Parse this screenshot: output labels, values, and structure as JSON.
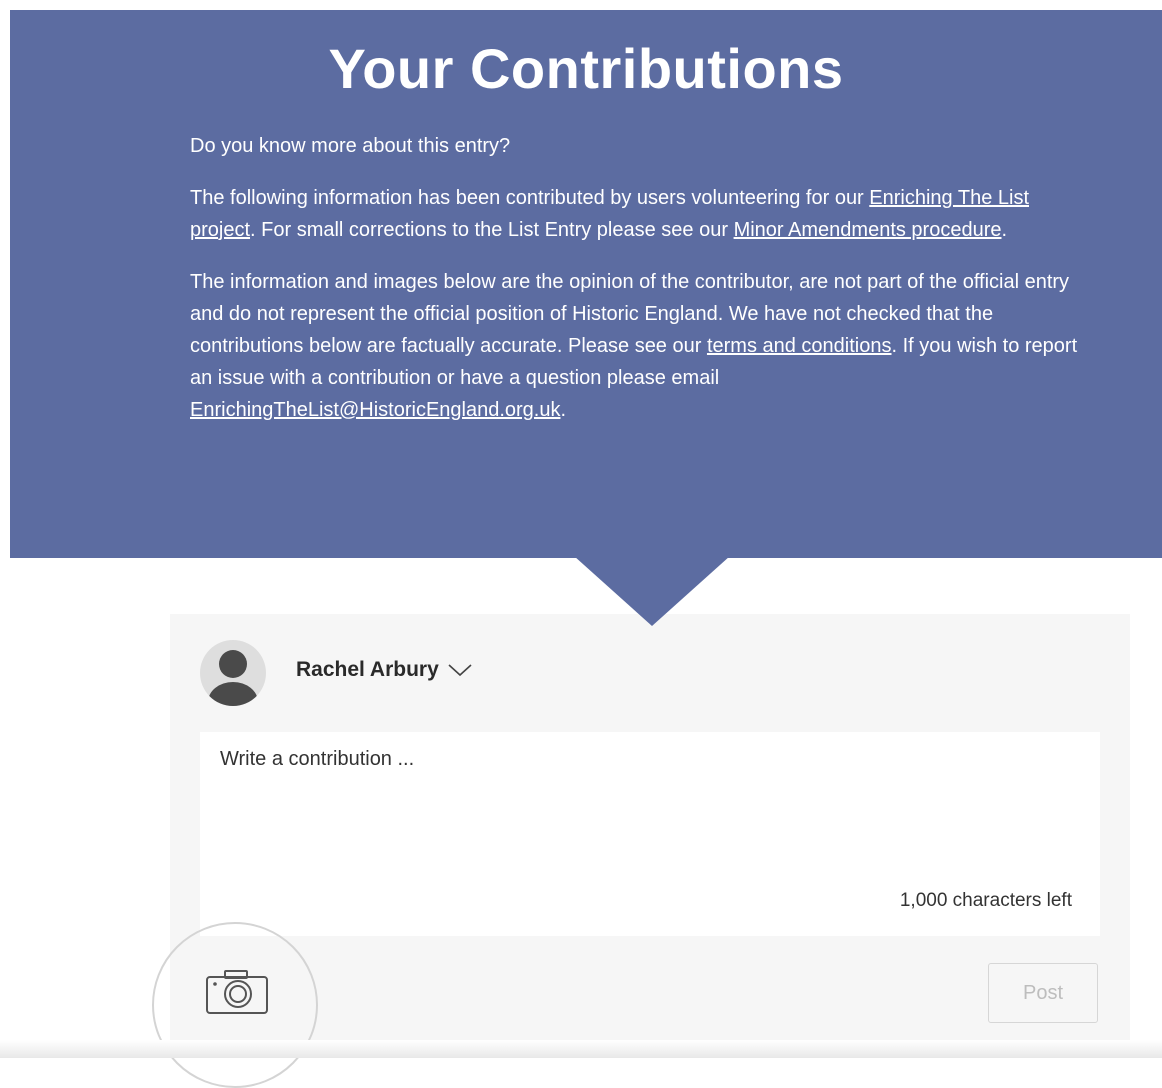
{
  "hero": {
    "title": "Your Contributions",
    "question": "Do you know more about this entry?",
    "p2_pre": "The following information has been contributed by users volunteering for our ",
    "p2_link1": "Enriching The List project",
    "p2_mid": ". For small corrections to the List Entry please see our ",
    "p2_link2": "Minor Amendments procedure",
    "p2_post": ".",
    "p3_pre": "The information and images below are the opinion of the contributor, are not part of the official entry and do not represent the official position of Historic England. We have not checked that the contributions below are factually accurate. Please see our ",
    "p3_link1": "terms and conditions",
    "p3_mid": ". If you wish to report an issue with a contribution or have a question please email ",
    "p3_link2": "EnrichingTheList@HistoricEngland.org.uk",
    "p3_post": "."
  },
  "composer": {
    "user_name": "Rachel Arbury",
    "placeholder": "Write a contribution ...",
    "chars_left": "1,000 characters left",
    "post_label": "Post"
  },
  "icons": {
    "avatar": "user-avatar-icon",
    "chevron": "chevron-down-icon",
    "camera": "camera-icon"
  },
  "colors": {
    "hero_bg": "#5c6ca1",
    "panel_bg": "#f6f6f6"
  }
}
